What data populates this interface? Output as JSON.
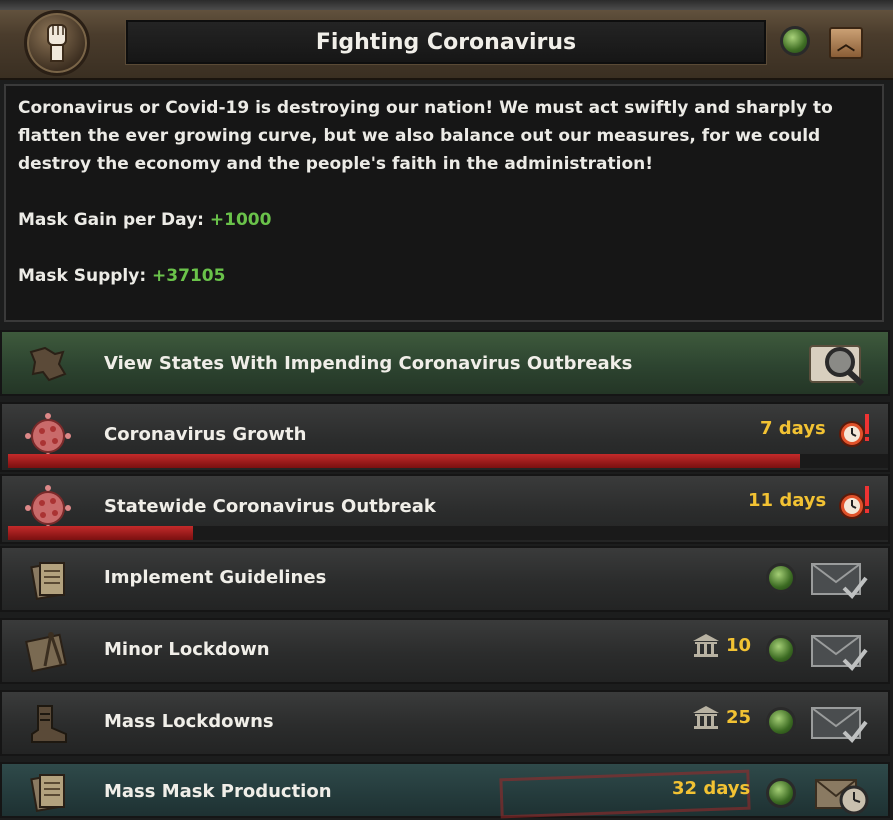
{
  "header": {
    "title": "Fighting Coronavirus",
    "icon": "raised-fist-icon",
    "status_icon": "green-orb-icon",
    "collapse_icon": "chevron-up-icon"
  },
  "description": {
    "text": "Coronavirus or Covid-19 is destroying our nation! We must act swiftly and sharply to flatten the ever growing curve, but we also balance out our measures, for we could destroy the economy and the people's faith in the administration!",
    "mask_gain_label": "Mask Gain per Day:",
    "mask_gain_value": "+1000",
    "mask_supply_label": "Mask Supply:",
    "mask_supply_value": "+37105"
  },
  "rows": [
    {
      "label": "View States With Impending Coronavirus Outbreaks",
      "icon": "map-region-icon",
      "action_icon": "magnifier-icon",
      "style": "green"
    },
    {
      "label": "Coronavirus Growth",
      "icon": "virus-icon",
      "days": "7 days",
      "timer_icon": "alarm-clock-icon",
      "progress": 0.9
    },
    {
      "label": "Statewide Coronavirus Outbreak",
      "icon": "virus-icon",
      "days": "11 days",
      "timer_icon": "alarm-clock-icon",
      "progress": 0.21
    },
    {
      "label": "Implement Guidelines",
      "icon": "documents-icon",
      "action_icon": "envelope-check-icon"
    },
    {
      "label": "Minor Lockdown",
      "icon": "map-compass-icon",
      "cost": "10",
      "cost_icon": "political-power-icon",
      "action_icon": "envelope-check-icon"
    },
    {
      "label": "Mass Lockdowns",
      "icon": "boot-icon",
      "cost": "25",
      "cost_icon": "political-power-icon",
      "action_icon": "envelope-check-icon"
    },
    {
      "label": "Mass Mask Production",
      "icon": "documents-icon",
      "days": "32 days",
      "action_icon": "envelope-timer-icon",
      "style": "teal"
    }
  ],
  "colors": {
    "accent_green": "#6ac24a",
    "days_yellow": "#f2c233",
    "progress_red": "#c42a2a",
    "header_brown": "#4a3c2c"
  }
}
